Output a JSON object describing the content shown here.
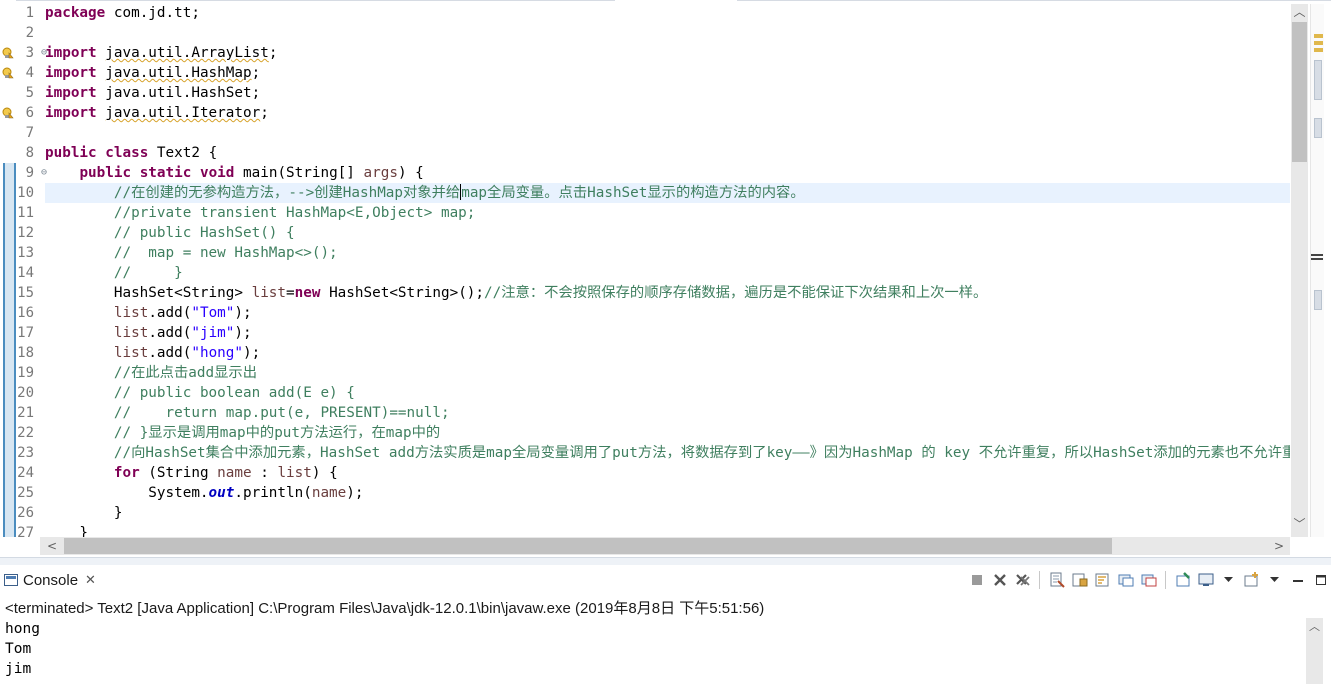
{
  "editor": {
    "lines": [
      {
        "num": "1",
        "segments": [
          {
            "t": "package",
            "c": "kw"
          },
          {
            "t": " com.jd.tt;"
          }
        ]
      },
      {
        "num": "2",
        "segments": []
      },
      {
        "num": "3",
        "fold": "⊖",
        "warn": true,
        "segments": [
          {
            "t": "import",
            "c": "kw"
          },
          {
            "t": " "
          },
          {
            "t": "java.util.ArrayList",
            "c": "squig"
          },
          {
            "t": ";"
          }
        ]
      },
      {
        "num": "4",
        "warn": true,
        "segments": [
          {
            "t": "import",
            "c": "kw"
          },
          {
            "t": " "
          },
          {
            "t": "java.util.HashMap",
            "c": "squig"
          },
          {
            "t": ";"
          }
        ]
      },
      {
        "num": "5",
        "segments": [
          {
            "t": "import",
            "c": "kw"
          },
          {
            "t": " java.util.HashSet;"
          }
        ]
      },
      {
        "num": "6",
        "warn": true,
        "segments": [
          {
            "t": "import",
            "c": "kw"
          },
          {
            "t": " "
          },
          {
            "t": "java.util.Iterator",
            "c": "squig"
          },
          {
            "t": ";"
          }
        ]
      },
      {
        "num": "7",
        "segments": []
      },
      {
        "num": "8",
        "segments": [
          {
            "t": "public",
            "c": "kw"
          },
          {
            "t": " "
          },
          {
            "t": "class",
            "c": "kw"
          },
          {
            "t": " Text2 {"
          }
        ]
      },
      {
        "num": "9",
        "fold": "⊖",
        "segments": [
          {
            "t": "    "
          },
          {
            "t": "public",
            "c": "kw"
          },
          {
            "t": " "
          },
          {
            "t": "static",
            "c": "kw"
          },
          {
            "t": " "
          },
          {
            "t": "void",
            "c": "kw"
          },
          {
            "t": " main(String[] "
          },
          {
            "t": "args",
            "c": "prm"
          },
          {
            "t": ") {"
          }
        ]
      },
      {
        "num": "10",
        "current": true,
        "segments": [
          {
            "t": "        "
          },
          {
            "t": "//在创建的无参构造方法，-->创建HashMap对象并给",
            "c": "cm"
          },
          {
            "caret": true
          },
          {
            "t": "map全局变量。点击HashSet显示的构造方法的内容。",
            "c": "cm"
          }
        ]
      },
      {
        "num": "11",
        "segments": [
          {
            "t": "        "
          },
          {
            "t": "//private transient HashMap<E,Object> map;",
            "c": "cm"
          }
        ]
      },
      {
        "num": "12",
        "segments": [
          {
            "t": "        "
          },
          {
            "t": "// public HashSet() {",
            "c": "cm"
          }
        ]
      },
      {
        "num": "13",
        "segments": [
          {
            "t": "        "
          },
          {
            "t": "//  map = new HashMap<>();",
            "c": "cm"
          }
        ]
      },
      {
        "num": "14",
        "segments": [
          {
            "t": "        "
          },
          {
            "t": "//     }",
            "c": "cm"
          }
        ]
      },
      {
        "num": "15",
        "segments": [
          {
            "t": "        HashSet<String> "
          },
          {
            "t": "list",
            "c": "prm"
          },
          {
            "t": "="
          },
          {
            "t": "new",
            "c": "kw"
          },
          {
            "t": " HashSet<String>();"
          },
          {
            "t": "//注意：不会按照保存的顺序存储数据，遍历是不能保证下次结果和上次一样。",
            "c": "cm"
          }
        ]
      },
      {
        "num": "16",
        "segments": [
          {
            "t": "        "
          },
          {
            "t": "list",
            "c": "prm"
          },
          {
            "t": ".add("
          },
          {
            "t": "\"Tom\"",
            "c": "st"
          },
          {
            "t": ");"
          }
        ]
      },
      {
        "num": "17",
        "segments": [
          {
            "t": "        "
          },
          {
            "t": "list",
            "c": "prm"
          },
          {
            "t": ".add("
          },
          {
            "t": "\"jim\"",
            "c": "st"
          },
          {
            "t": ");"
          }
        ]
      },
      {
        "num": "18",
        "segments": [
          {
            "t": "        "
          },
          {
            "t": "list",
            "c": "prm"
          },
          {
            "t": ".add("
          },
          {
            "t": "\"hong\"",
            "c": "st"
          },
          {
            "t": ");"
          }
        ]
      },
      {
        "num": "19",
        "segments": [
          {
            "t": "        "
          },
          {
            "t": "//在此点击add显示出",
            "c": "cm"
          }
        ]
      },
      {
        "num": "20",
        "segments": [
          {
            "t": "        "
          },
          {
            "t": "// public boolean add(E e) {",
            "c": "cm"
          }
        ]
      },
      {
        "num": "21",
        "segments": [
          {
            "t": "        "
          },
          {
            "t": "//    return map.put(e, PRESENT)==null;",
            "c": "cm"
          }
        ]
      },
      {
        "num": "22",
        "segments": [
          {
            "t": "        "
          },
          {
            "t": "// }显示是调用map中的put方法运行，在map中的",
            "c": "cm"
          }
        ]
      },
      {
        "num": "23",
        "segments": [
          {
            "t": "        "
          },
          {
            "t": "//向HashSet集合中添加元素，HashSet add方法实质是map全局变量调用了put方法，将数据存到了key——》因为HashMap 的 key 不允许重复，所以HashSet添加的元素也不允许重复",
            "c": "cm"
          }
        ]
      },
      {
        "num": "24",
        "segments": [
          {
            "t": "        "
          },
          {
            "t": "for",
            "c": "kw"
          },
          {
            "t": " (String "
          },
          {
            "t": "name",
            "c": "prm"
          },
          {
            "t": " : "
          },
          {
            "t": "list",
            "c": "prm"
          },
          {
            "t": ") {"
          }
        ]
      },
      {
        "num": "25",
        "segments": [
          {
            "t": "            System."
          },
          {
            "t": "out",
            "c": "fld"
          },
          {
            "t": ".println("
          },
          {
            "t": "name",
            "c": "prm"
          },
          {
            "t": ");"
          }
        ]
      },
      {
        "num": "26",
        "segments": [
          {
            "t": "        }"
          }
        ]
      },
      {
        "num": "27",
        "segments": [
          {
            "t": "    }"
          }
        ]
      }
    ],
    "scroll_up_glyph": "︿",
    "scroll_down_glyph": "﹀",
    "scroll_left_glyph": "<",
    "scroll_right_glyph": ">"
  },
  "console": {
    "title": "Console",
    "close_glyph": "✕",
    "status": "<terminated> Text2 [Java Application] C:\\Program Files\\Java\\jdk-12.0.1\\bin\\javaw.exe (2019年8月8日 下午5:51:56)",
    "output": [
      "hong",
      "Tom",
      "jim"
    ],
    "toolbar_icons": [
      "terminate-icon",
      "remove-launch-icon",
      "remove-all-terminated-icon",
      "clear-console-icon",
      "scroll-lock-icon",
      "word-wrap-icon",
      "show-on-stdout-icon",
      "show-on-stderr-icon",
      "pin-console-icon",
      "display-console-icon",
      "open-console-icon",
      "minimize-icon",
      "maximize-icon"
    ],
    "scroll_up_glyph": "︿"
  },
  "colors": {
    "keyword": "#7f0055",
    "comment": "#3f7f5f",
    "string": "#2a00ff",
    "field": "#0000c0",
    "current_line": "#e8f2fe",
    "fold_ruler": "#4b8dbf"
  }
}
